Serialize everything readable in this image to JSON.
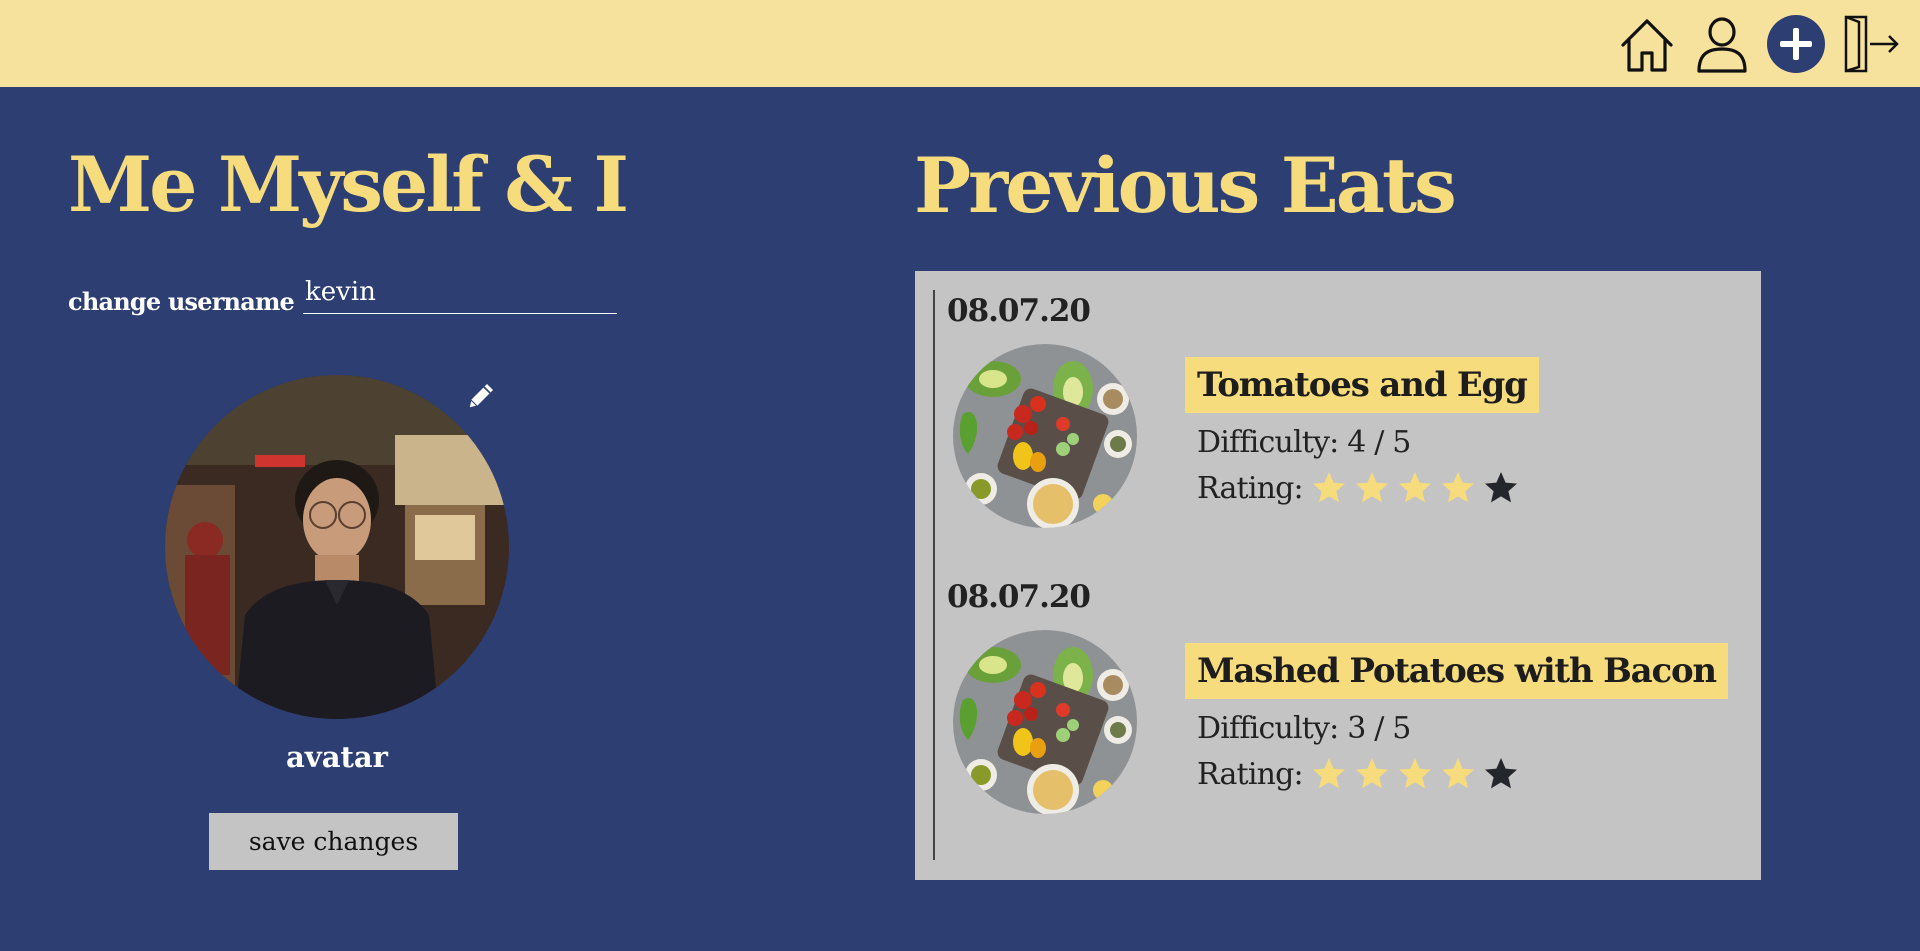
{
  "nav": {
    "items": [
      {
        "name": "home-icon",
        "label": "Home"
      },
      {
        "name": "user-icon",
        "label": "Profile"
      },
      {
        "name": "plus-icon",
        "label": "Add"
      },
      {
        "name": "logout-icon",
        "label": "Log out"
      }
    ]
  },
  "colors": {
    "topbar": "#f6e29d",
    "background": "#2d3e73",
    "accent": "#f6dc7c",
    "panel": "#c4c4c4",
    "star_filled": "#f6dc7c",
    "star_empty": "#23262b"
  },
  "profile": {
    "title": "Me Myself & I",
    "username_label": "change username",
    "username_value": "kevin",
    "avatar_label": "avatar",
    "save_label": "save changes"
  },
  "eats": {
    "title": "Previous Eats",
    "entries": [
      {
        "date": "08.07.20",
        "dish": "Tomatoes and Egg",
        "difficulty": "Difficulty: 4 / 5",
        "rating_label": "Rating:",
        "rating": 4,
        "rating_max": 5
      },
      {
        "date": "08.07.20",
        "dish": "Mashed Potatoes with Bacon",
        "difficulty": "Difficulty: 3 / 5",
        "rating_label": "Rating:",
        "rating": 4,
        "rating_max": 5
      }
    ]
  }
}
